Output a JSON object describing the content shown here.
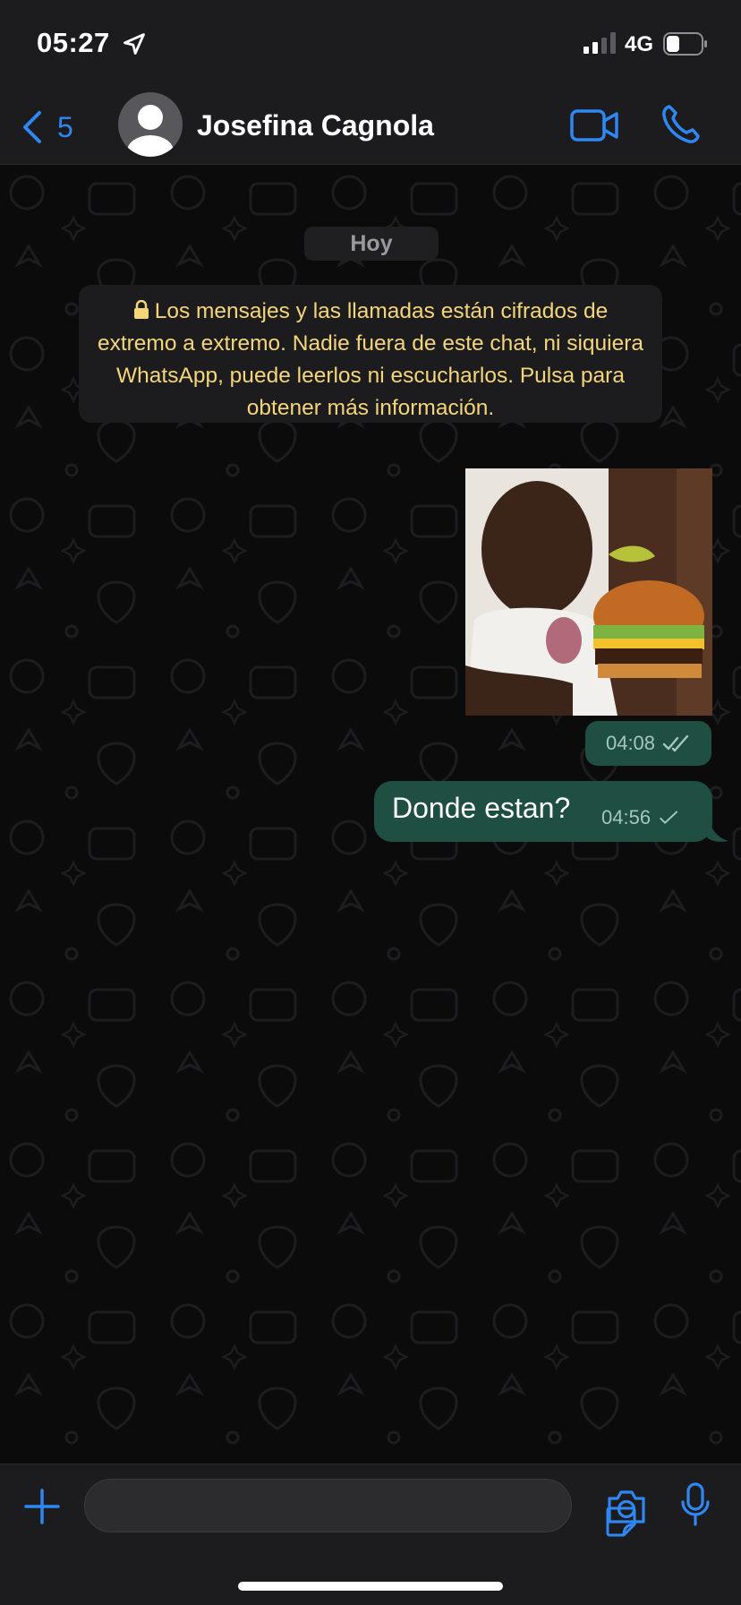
{
  "status_bar": {
    "time": "05:27",
    "network": "4G",
    "icons": [
      "location-arrow-icon",
      "signal-icon",
      "battery-icon"
    ]
  },
  "header": {
    "back_count": "5",
    "contact_name": "Josefina Cagnola",
    "icons": [
      "back-chevron-icon",
      "avatar-icon",
      "video-camera-icon",
      "phone-icon"
    ]
  },
  "chat": {
    "date_label": "Hoy",
    "encryption_notice": "Los mensajes y las llamadas están cifrados de extremo a extremo. Nadie fuera de este chat, ni siquiera WhatsApp, puede leerlos ni escucharlos. Pulsa para obtener más información.",
    "messages": [
      {
        "type": "image",
        "direction": "outgoing",
        "time": "04:08",
        "status": "read",
        "status_icon": "double-check-icon"
      },
      {
        "type": "text",
        "direction": "outgoing",
        "text": "Donde estan?",
        "time": "04:56",
        "status": "sent",
        "status_icon": "single-check-icon"
      }
    ]
  },
  "input_bar": {
    "placeholder": "",
    "icons": [
      "plus-icon",
      "sticker-icon",
      "camera-icon",
      "microphone-icon"
    ]
  },
  "colors": {
    "accent": "#2f87f4",
    "outgoing_bubble": "#1f4e43",
    "notice_text": "#f5d57a",
    "background": "#0b0b0c",
    "bar_background": "#1c1c1e"
  }
}
